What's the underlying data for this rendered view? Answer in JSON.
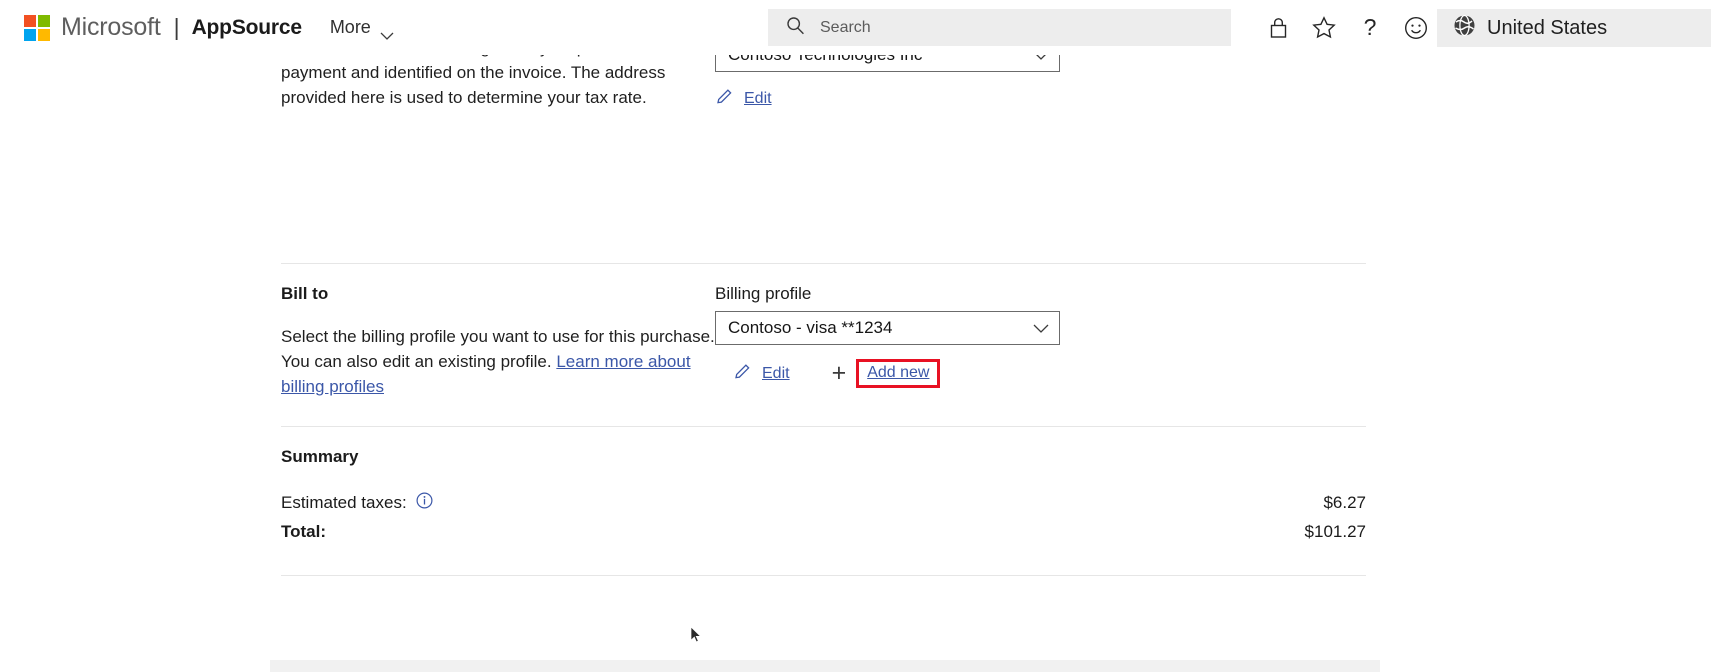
{
  "header": {
    "brand_microsoft": "Microsoft",
    "brand_divider": "|",
    "brand_app": "AppSource",
    "more_label": "More",
    "search_placeholder": "Search",
    "icons": [
      "lock-icon",
      "star-icon",
      "help-icon",
      "smiley-icon"
    ],
    "region_label": "United States",
    "logo_colors": {
      "red": "#f25022",
      "green": "#7fba00",
      "blue": "#00a4ef",
      "yellow": "#ffb900"
    }
  },
  "sell_to": {
    "description": "Enter the address of the legal entity responsible for payment and identified on the invoice. The address provided here is used to determine your tax rate.",
    "combo_value": "Contoso Technologies Inc",
    "edit_label": "Edit"
  },
  "bill_to": {
    "title": "Bill to",
    "description_part1": "Select the billing profile you want to use for this purchase. You can also edit an existing profile. ",
    "description_link": "Learn more about billing profiles",
    "field_label": "Billing profile",
    "combo_value": "Contoso - visa **1234",
    "edit_label": "Edit",
    "add_new_label": "Add new",
    "highlight_color": "#e81123"
  },
  "summary": {
    "title": "Summary",
    "estimated_taxes_label": "Estimated taxes:",
    "estimated_taxes_value": "$6.27",
    "total_label": "Total:",
    "total_value": "$101.27"
  }
}
